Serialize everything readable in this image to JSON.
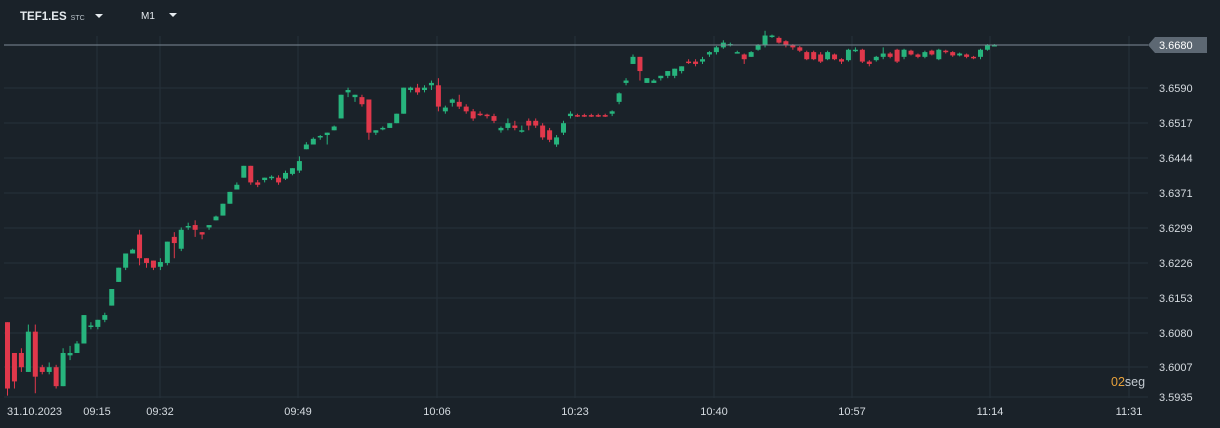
{
  "header": {
    "symbol": "TEF1.ES",
    "symbol_type": "STC",
    "timeframe": "M1"
  },
  "countdown": {
    "value": "02",
    "unit": "seg"
  },
  "colors": {
    "background": "#1a2229",
    "grid": "#26313a",
    "up": "#27b47d",
    "down": "#e0384b",
    "axis_text": "#d5dbe0",
    "price_line": "#7d8a96",
    "price_label_bg": "#5d6873"
  },
  "chart_data": {
    "type": "candlestick",
    "title": "",
    "xlabel": "",
    "ylabel": "",
    "ylim": [
      3.5915,
      3.6705
    ],
    "date_label": "31.10.2023",
    "x_ticks": [
      "09:15",
      "09:32",
      "09:49",
      "10:06",
      "10:23",
      "10:40",
      "10:57",
      "11:14",
      "11:31"
    ],
    "y_ticks": [
      "3.5935",
      "3.6007",
      "3.6080",
      "3.6153",
      "3.6226",
      "3.6299",
      "3.6371",
      "3.6444",
      "3.6517",
      "3.6590",
      "3.6680"
    ],
    "grid": true,
    "current_price": "3.6680",
    "candles": [
      [
        3.6095,
        3.5955,
        3.594,
        3.6095
      ],
      [
        3.603,
        3.597,
        3.5955,
        3.603
      ],
      [
        3.603,
        3.6,
        3.599,
        3.604
      ],
      [
        3.599,
        3.6075,
        3.599,
        3.609
      ],
      [
        3.6075,
        3.598,
        3.5945,
        3.609
      ],
      [
        3.6,
        3.599,
        3.5985,
        3.6005
      ],
      [
        3.599,
        3.6,
        3.5985,
        3.601
      ],
      [
        3.6,
        3.596,
        3.5955,
        3.6005
      ],
      [
        3.596,
        3.603,
        3.596,
        3.604
      ],
      [
        3.6025,
        3.603,
        3.6015,
        3.6045
      ],
      [
        3.603,
        3.605,
        3.603,
        3.6055
      ],
      [
        3.605,
        3.611,
        3.605,
        3.611
      ],
      [
        3.6085,
        3.6088,
        3.608,
        3.6095
      ],
      [
        3.6085,
        3.61,
        3.608,
        3.61
      ],
      [
        3.61,
        3.611,
        3.6095,
        3.6115
      ],
      [
        3.613,
        3.6165,
        3.613,
        3.6165
      ],
      [
        3.618,
        3.621,
        3.618,
        3.621
      ],
      [
        3.621,
        3.624,
        3.6205,
        3.624
      ],
      [
        3.624,
        3.6248,
        3.624,
        3.625
      ],
      [
        3.628,
        3.623,
        3.6215,
        3.629
      ],
      [
        3.623,
        3.622,
        3.621,
        3.623
      ],
      [
        3.6225,
        3.621,
        3.6205,
        3.6225
      ],
      [
        3.6212,
        3.6222,
        3.6205,
        3.623
      ],
      [
        3.622,
        3.6265,
        3.6215,
        3.6265
      ],
      [
        3.6275,
        3.6262,
        3.623,
        3.6285
      ],
      [
        3.625,
        3.629,
        3.6245,
        3.6295
      ],
      [
        3.6295,
        3.6298,
        3.629,
        3.6305
      ],
      [
        3.63,
        3.629,
        3.6275,
        3.631
      ],
      [
        3.6285,
        3.628,
        3.627,
        3.6285
      ],
      [
        3.6295,
        3.63,
        3.629,
        3.63
      ],
      [
        3.631,
        3.6318,
        3.631,
        3.632
      ],
      [
        3.632,
        3.6345,
        3.632,
        3.6345
      ],
      [
        3.6345,
        3.637,
        3.6345,
        3.637
      ],
      [
        3.6375,
        3.6385,
        3.6375,
        3.639
      ],
      [
        3.64,
        3.6425,
        3.64,
        3.6425
      ],
      [
        3.6425,
        3.639,
        3.6385,
        3.6425
      ],
      [
        3.639,
        3.6385,
        3.638,
        3.6395
      ],
      [
        3.6395,
        3.64,
        3.639,
        3.64
      ],
      [
        3.64,
        3.6402,
        3.6395,
        3.6405
      ],
      [
        3.64,
        3.639,
        3.6385,
        3.6405
      ],
      [
        3.6398,
        3.641,
        3.6395,
        3.6415
      ],
      [
        3.6408,
        3.642,
        3.6405,
        3.642
      ],
      [
        3.6415,
        3.6435,
        3.641,
        3.6445
      ],
      [
        3.646,
        3.647,
        3.646,
        3.6475
      ],
      [
        3.647,
        3.6482,
        3.647,
        3.6485
      ],
      [
        3.6485,
        3.6488,
        3.648,
        3.649
      ],
      [
        3.649,
        3.6495,
        3.647,
        3.6495
      ],
      [
        3.65,
        3.6508,
        3.65,
        3.651
      ],
      [
        3.6525,
        3.6575,
        3.6525,
        3.6575
      ],
      [
        3.658,
        3.6585,
        3.657,
        3.659
      ],
      [
        3.657,
        3.6575,
        3.656,
        3.6575
      ],
      [
        3.657,
        3.6555,
        3.655,
        3.6575
      ],
      [
        3.6565,
        3.6495,
        3.648,
        3.6565
      ],
      [
        3.6495,
        3.65,
        3.649,
        3.65
      ],
      [
        3.6505,
        3.6505,
        3.65,
        3.6508
      ],
      [
        3.6505,
        3.6515,
        3.6505,
        3.6515
      ],
      [
        3.6515,
        3.6535,
        3.6515,
        3.6535
      ],
      [
        3.6535,
        3.659,
        3.6535,
        3.659
      ],
      [
        3.6585,
        3.659,
        3.658,
        3.6592
      ],
      [
        3.659,
        3.658,
        3.6575,
        3.6598
      ],
      [
        3.6585,
        3.659,
        3.658,
        3.6595
      ],
      [
        3.6595,
        3.66,
        3.6585,
        3.6605
      ],
      [
        3.6595,
        3.655,
        3.654,
        3.661
      ],
      [
        3.654,
        3.6548,
        3.6535,
        3.6552
      ],
      [
        3.6558,
        3.6565,
        3.655,
        3.6567
      ],
      [
        3.656,
        3.655,
        3.6545,
        3.6575
      ],
      [
        3.655,
        3.654,
        3.6535,
        3.6555
      ],
      [
        3.654,
        3.6525,
        3.652,
        3.6545
      ],
      [
        3.6535,
        3.6533,
        3.653,
        3.654
      ],
      [
        3.6533,
        3.653,
        3.6525,
        3.6535
      ],
      [
        3.653,
        3.652,
        3.6515,
        3.6535
      ],
      [
        3.65,
        3.6505,
        3.6495,
        3.6508
      ],
      [
        3.6505,
        3.6515,
        3.65,
        3.6525
      ],
      [
        3.651,
        3.6505,
        3.65,
        3.652
      ],
      [
        3.65,
        3.65,
        3.6495,
        3.651
      ],
      [
        3.652,
        3.651,
        3.65,
        3.6525
      ],
      [
        3.652,
        3.651,
        3.6505,
        3.6525
      ],
      [
        3.651,
        3.6485,
        3.648,
        3.6515
      ],
      [
        3.65,
        3.648,
        3.6475,
        3.6505
      ],
      [
        3.647,
        3.6485,
        3.6465,
        3.649
      ],
      [
        3.6495,
        3.6515,
        3.649,
        3.652
      ],
      [
        3.653,
        3.6535,
        3.6525,
        3.654
      ],
      [
        3.6532,
        3.653,
        3.6528,
        3.6535
      ],
      [
        3.6532,
        3.653,
        3.6528,
        3.6535
      ],
      [
        3.6532,
        3.653,
        3.6528,
        3.6535
      ],
      [
        3.6532,
        3.653,
        3.6528,
        3.6535
      ],
      [
        3.6532,
        3.653,
        3.6528,
        3.6535
      ],
      [
        3.6535,
        3.654,
        3.653,
        3.6542
      ],
      [
        3.656,
        3.6578,
        3.6555,
        3.658
      ],
      [
        3.66,
        3.6605,
        3.6595,
        3.661
      ],
      [
        3.664,
        3.6655,
        3.664,
        3.666
      ],
      [
        3.6655,
        3.6625,
        3.6605,
        3.6655
      ],
      [
        3.66,
        3.661,
        3.66,
        3.661
      ],
      [
        3.66,
        3.6605,
        3.66,
        3.6608
      ],
      [
        3.661,
        3.6615,
        3.6605,
        3.6615
      ],
      [
        3.6615,
        3.6625,
        3.661,
        3.6625
      ],
      [
        3.6615,
        3.663,
        3.661,
        3.663
      ],
      [
        3.6625,
        3.6635,
        3.662,
        3.6635
      ],
      [
        3.6645,
        3.6643,
        3.664,
        3.665
      ],
      [
        3.6645,
        3.664,
        3.6635,
        3.665
      ],
      [
        3.6645,
        3.665,
        3.664,
        3.6655
      ],
      [
        3.666,
        3.6665,
        3.6655,
        3.6667
      ],
      [
        3.6665,
        3.6675,
        3.666,
        3.6678
      ],
      [
        3.6675,
        3.6685,
        3.6672,
        3.669
      ],
      [
        3.668,
        3.6682,
        3.6677,
        3.6685
      ],
      [
        3.6665,
        3.6665,
        3.6662,
        3.6668
      ],
      [
        3.666,
        3.665,
        3.664,
        3.6662
      ],
      [
        3.6655,
        3.6665,
        3.6655,
        3.6667
      ],
      [
        3.667,
        3.668,
        3.6668,
        3.6682
      ],
      [
        3.668,
        3.67,
        3.6675,
        3.671
      ],
      [
        3.67,
        3.67,
        3.6695,
        3.6702
      ],
      [
        3.6695,
        3.6685,
        3.6683,
        3.6698
      ],
      [
        3.6688,
        3.668,
        3.6675,
        3.669
      ],
      [
        3.668,
        3.6675,
        3.667,
        3.6682
      ],
      [
        3.6675,
        3.6668,
        3.6665,
        3.6678
      ],
      [
        3.6665,
        3.665,
        3.6648,
        3.6668
      ],
      [
        3.6665,
        3.665,
        3.6648,
        3.6668
      ],
      [
        3.666,
        3.6645,
        3.6642,
        3.6665
      ],
      [
        3.665,
        3.6665,
        3.6648,
        3.6668
      ],
      [
        3.666,
        3.665,
        3.6648,
        3.6662
      ],
      [
        3.665,
        3.6645,
        3.664,
        3.6652
      ],
      [
        3.6648,
        3.667,
        3.6645,
        3.6672
      ],
      [
        3.667,
        3.667,
        3.6665,
        3.6675
      ],
      [
        3.667,
        3.6645,
        3.6642,
        3.6672
      ],
      [
        3.6645,
        3.664,
        3.6635,
        3.6648
      ],
      [
        3.6648,
        3.6655,
        3.6645,
        3.6657
      ],
      [
        3.6655,
        3.6662,
        3.665,
        3.6675
      ],
      [
        3.6662,
        3.6655,
        3.6652,
        3.6665
      ],
      [
        3.667,
        3.6645,
        3.6642,
        3.6672
      ],
      [
        3.6655,
        3.667,
        3.665,
        3.6672
      ],
      [
        3.6668,
        3.666,
        3.6658,
        3.667
      ],
      [
        3.666,
        3.6655,
        3.6652,
        3.6662
      ],
      [
        3.6655,
        3.6665,
        3.6652,
        3.6668
      ],
      [
        3.6668,
        3.666,
        3.6658,
        3.667
      ],
      [
        3.665,
        3.667,
        3.6648,
        3.6672
      ],
      [
        3.6668,
        3.6665,
        3.6662,
        3.667
      ],
      [
        3.6665,
        3.6658,
        3.6655,
        3.6667
      ],
      [
        3.6658,
        3.6662,
        3.6656,
        3.6664
      ],
      [
        3.666,
        3.6655,
        3.6652,
        3.6662
      ],
      [
        3.6655,
        3.6652,
        3.665,
        3.6657
      ],
      [
        3.6655,
        3.667,
        3.665,
        3.6672
      ],
      [
        3.667,
        3.668,
        3.6668,
        3.6682
      ],
      [
        3.668,
        3.668,
        3.6678,
        3.6682
      ]
    ]
  }
}
